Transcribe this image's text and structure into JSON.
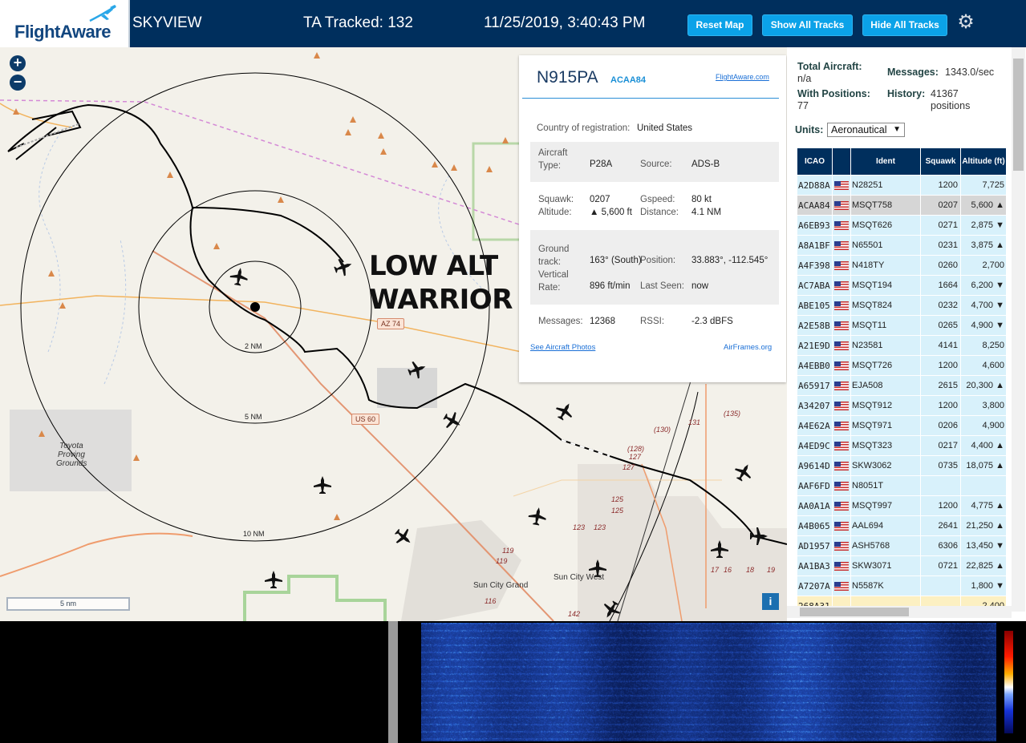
{
  "header": {
    "logo_text": "FlightAware",
    "app_title": "SKYVIEW",
    "tracked": "TA Tracked: 132",
    "datetime": "11/25/2019, 3:40:43 PM",
    "buttons": {
      "reset": "Reset Map",
      "show": "Show All Tracks",
      "hide": "Hide All Tracks"
    },
    "settings_icon": "gear-icon"
  },
  "map": {
    "zoom_in": "+",
    "zoom_out": "−",
    "annotation_line1": "LOW ALT",
    "annotation_line2": "WARRIOR",
    "rings": [
      "2 NM",
      "5 NM",
      "10 NM"
    ],
    "scale": "5 nm",
    "info": "i",
    "place_labels": [
      "Toyota",
      "Proving",
      "Grounds",
      "Sun City West",
      "Sun City Grand"
    ],
    "road_labels": [
      "AZ 74",
      "US 60"
    ],
    "road_numbers": [
      "131",
      "(130)",
      "(135)",
      "(128)",
      "127",
      "127",
      "125",
      "125",
      "123",
      "123",
      "119",
      "119",
      "116",
      "142",
      "17",
      "16",
      "18",
      "19"
    ]
  },
  "detail": {
    "registration": "N915PA",
    "hex": "ACAA84",
    "fa_link": "FlightAware.com",
    "country_label": "Country of registration:",
    "country": "United States",
    "aircraft_type_label": "Aircraft Type:",
    "aircraft_type": "P28A",
    "source_label": "Source:",
    "source": "ADS-B",
    "squawk_label": "Squawk:",
    "squawk": "0207",
    "altitude_label": "Altitude:",
    "altitude": "▲ 5,600 ft",
    "gspeed_label": "Gspeed:",
    "gspeed": "80 kt",
    "distance_label": "Distance:",
    "distance": "4.1 NM",
    "track_label": "Ground track:",
    "track": "163° (South)",
    "position_label": "Position:",
    "position": "33.883°, -112.545°",
    "vrate_label": "Vertical Rate:",
    "vrate": "896 ft/min",
    "last_seen_label": "Last Seen:",
    "last_seen": "now",
    "messages_label": "Messages:",
    "messages": "12368",
    "rssi_label": "RSSI:",
    "rssi": "-2.3 dBFS",
    "photos_link": "See Aircraft Photos",
    "airframes_link": "AirFrames.org"
  },
  "panel": {
    "total_label": "Total Aircraft:",
    "total_value": "n/a",
    "messages_label": "Messages:",
    "messages_value": "1343.0/sec",
    "positions_label": "With Positions:",
    "positions_value": "77",
    "history_label": "History:",
    "history_value": "41367 positions",
    "units_label": "Units:",
    "units_value": "Aeronautical",
    "columns": [
      "ICAO",
      "",
      "Ident",
      "Squawk",
      "Altitude (ft)"
    ],
    "rows": [
      {
        "icao": "A2D88A",
        "ident": "N28251",
        "squawk": "1200",
        "alt": "7,725"
      },
      {
        "icao": "ACAA84",
        "ident": "MSQT758",
        "squawk": "0207",
        "alt": "5,600 ▲"
      },
      {
        "icao": "A6EB93",
        "ident": "MSQT626",
        "squawk": "0271",
        "alt": "2,875 ▼"
      },
      {
        "icao": "A8A1BF",
        "ident": "N65501",
        "squawk": "0231",
        "alt": "3,875 ▲"
      },
      {
        "icao": "A4F398",
        "ident": "N418TY",
        "squawk": "0260",
        "alt": "2,700"
      },
      {
        "icao": "AC7ABA",
        "ident": "MSQT194",
        "squawk": "1664",
        "alt": "6,200 ▼"
      },
      {
        "icao": "ABE105",
        "ident": "MSQT824",
        "squawk": "0232",
        "alt": "4,700 ▼"
      },
      {
        "icao": "A2E58B",
        "ident": "MSQT11",
        "squawk": "0265",
        "alt": "4,900 ▼"
      },
      {
        "icao": "A21E9D",
        "ident": "N23581",
        "squawk": "4141",
        "alt": "8,250"
      },
      {
        "icao": "A4EBB0",
        "ident": "MSQT726",
        "squawk": "1200",
        "alt": "4,600"
      },
      {
        "icao": "A65917",
        "ident": "EJA508",
        "squawk": "2615",
        "alt": "20,300 ▲"
      },
      {
        "icao": "A34207",
        "ident": "MSQT912",
        "squawk": "1200",
        "alt": "3,800"
      },
      {
        "icao": "A4E62A",
        "ident": "MSQT971",
        "squawk": "0206",
        "alt": "4,900"
      },
      {
        "icao": "A4ED9C",
        "ident": "MSQT323",
        "squawk": "0217",
        "alt": "4,400 ▲"
      },
      {
        "icao": "A9614D",
        "ident": "SKW3062",
        "squawk": "0735",
        "alt": "18,075 ▲"
      },
      {
        "icao": "AAF6FD",
        "ident": "N8051T",
        "squawk": "",
        "alt": ""
      },
      {
        "icao": "AA0A1A",
        "ident": "MSQT997",
        "squawk": "1200",
        "alt": "4,775 ▲"
      },
      {
        "icao": "A4B065",
        "ident": "AAL694",
        "squawk": "2641",
        "alt": "21,250 ▲"
      },
      {
        "icao": "AD1957",
        "ident": "ASH5768",
        "squawk": "6306",
        "alt": "13,450 ▼"
      },
      {
        "icao": "AA1BA3",
        "ident": "SKW3071",
        "squawk": "0721",
        "alt": "22,825 ▲"
      },
      {
        "icao": "A7207A",
        "ident": "N5587K",
        "squawk": "",
        "alt": "1,800 ▼"
      },
      {
        "icao": "268A31",
        "ident": "",
        "squawk": "",
        "alt": "2,400"
      }
    ],
    "selected_icao": "ACAA84"
  }
}
